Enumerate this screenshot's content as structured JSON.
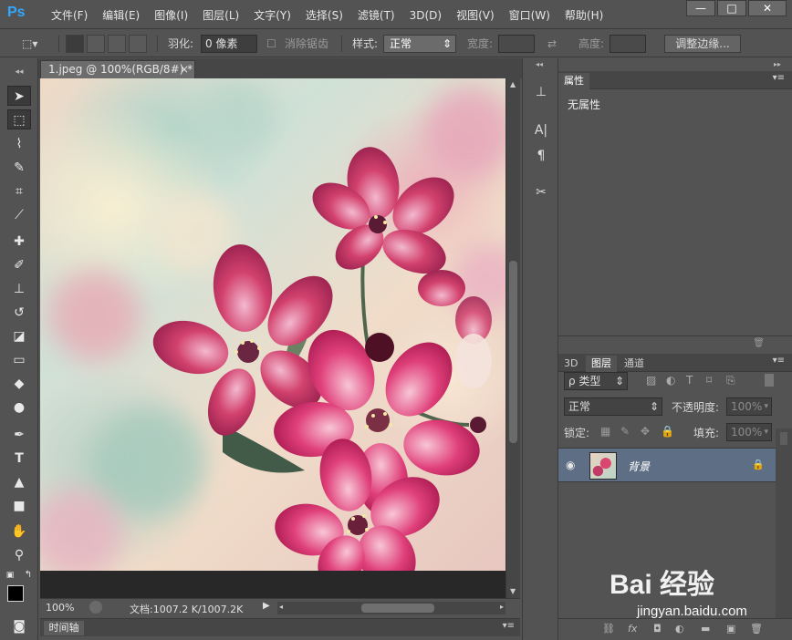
{
  "app": {
    "logo": "Ps"
  },
  "menu": [
    "文件(F)",
    "编辑(E)",
    "图像(I)",
    "图层(L)",
    "文字(Y)",
    "选择(S)",
    "滤镜(T)",
    "3D(D)",
    "视图(V)",
    "窗口(W)",
    "帮助(H)"
  ],
  "window_controls": {
    "minimize": "—",
    "maximize": "□",
    "close": "✕"
  },
  "options": {
    "feather_label": "羽化:",
    "feather_value": "0 像素",
    "antialias_label": "消除锯齿",
    "style_label": "样式:",
    "style_value": "正常",
    "width_label": "宽度:",
    "height_label": "高度:",
    "refine_edge": "调整边缘..."
  },
  "document": {
    "tab_title": "1.jpeg @ 100%(RGB/8#) *",
    "tab_close": "×",
    "zoom": "100%",
    "doc_info": "文档:1007.2 K/1007.2K"
  },
  "timeline": {
    "tab": "时间轴"
  },
  "properties": {
    "tab": "属性",
    "body": "无属性"
  },
  "layers": {
    "tabs": [
      "3D",
      "图层",
      "通道"
    ],
    "filter": "ρ 类型",
    "blend_mode": "正常",
    "opacity_label": "不透明度:",
    "opacity_value": "100%",
    "lock_label": "锁定:",
    "fill_label": "填充:",
    "fill_value": "100%",
    "items": [
      {
        "name": "背景",
        "visible": true,
        "locked": true
      }
    ]
  },
  "colors": {
    "foreground": "#000000",
    "background": "#ffffff",
    "selected_layer": "#5e6e84"
  },
  "watermark": {
    "brand": "Bai 经验",
    "url": "jingyan.baidu.com"
  }
}
